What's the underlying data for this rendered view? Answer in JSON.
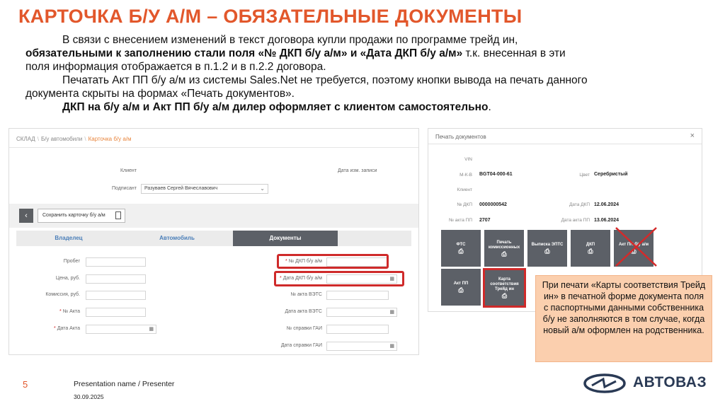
{
  "slide": {
    "title": "КАРТОЧКА Б/У А/М – ОБЯЗАТЕЛЬНЫЕ ДОКУМЕНТЫ",
    "p1_a": "В связи с внесением изменений в текст договора купли продажи по программе трейд ин,",
    "p1_b_bold": "обязательными к заполнению стали поля «№ ДКП б/у а/м» и «Дата ДКП б/у а/м»",
    "p1_b_rest": " т.к. внесенная в эти",
    "p1_c": "поля информация отображается в п.1.2 и в п.2.2 договора.",
    "p2_a": "Печатать Акт ПП б/у а/м из системы ",
    "p2_a_brand": "Sales.Net",
    "p2_a_rest": " не требуется, поэтому кнопки вывода на печать данного",
    "p2_b": "документа скрыты на формах «Печать документов».",
    "p3_bold": "ДКП на б/у а/м и Акт ПП б/у а/м дилер оформляет с клиентом самостоятельно",
    "p3_dot": "."
  },
  "card": {
    "breadcrumb": [
      "СКЛАД",
      "Б/у автомобили",
      "Карточка б/у а/м"
    ],
    "client_label": "Клиент",
    "signer_label": "Подписант",
    "signer_value": "Разуваев Сергей Вячеславович",
    "date_changed_label": "Дата изм. записи",
    "save_label": "Сохранить карточку б/у а/м",
    "tabs": [
      "Владелец",
      "Автомобиль",
      "Документы"
    ],
    "mileage_label": "Пробег",
    "price_label": "Цена, руб.",
    "commission_label": "Комиссия, руб.",
    "act_no_label": "№ Акта",
    "act_date_label": "Дата Акта",
    "dkp_no_label": "№ ДКП б/у а/м",
    "dkp_date_label": "Дата ДКП б/у а/м",
    "ets_no_label": "№ акта ВЭТС",
    "ets_date_label": "Дата акта ВЭТС",
    "gai_no_label": "№ справки ГАИ",
    "gai_date_label": "Дата справки ГАИ",
    "required_mark": "*"
  },
  "print_dialog": {
    "title": "Печать документов",
    "vin_label": "VIN",
    "mkv_label": "М-К-В",
    "mkv_value": "BGT04-000-61",
    "color_label": "Цвет",
    "color_value": "Серебристый",
    "client_label": "Клиент",
    "dkp_no_label": "№ ДКП",
    "dkp_no_value": "0000000542",
    "dkp_date_label": "Дата ДКП",
    "dkp_date_value": "12.06.2024",
    "act_no_label": "№ акта ПП",
    "act_no_value": "2707",
    "act_date_label": "Дата акта ПП",
    "act_date_value": "13.06.2024",
    "buttons": [
      "ФТС",
      "Печать комиссионных",
      "Выписка ЭПТС",
      "ДКП",
      "Акт ПП б/у а/м",
      "Акт ПП",
      "Карта соответствия Трейд ин"
    ]
  },
  "note": {
    "text": "При печати «Карты соответствия Трейд ин» в печатной форме документа поля с паспортными данными собственника б/у не заполняются в том случае, когда новый а/м оформлен на родственника."
  },
  "footer": {
    "page_number": "5",
    "presenter": "Presentation name / Presenter",
    "date": "30.09.2025",
    "brand": "АВТОВАЗ"
  },
  "colors": {
    "accent": "#e2572b",
    "highlight_red": "#cf2a2a",
    "note_bg": "#fbcfae",
    "button_dark": "#5c6067"
  },
  "icons": {
    "calendar": "calendar-icon",
    "printer": "printer-icon",
    "close": "close-icon",
    "back": "back-arrow-icon",
    "document": "document-icon"
  }
}
